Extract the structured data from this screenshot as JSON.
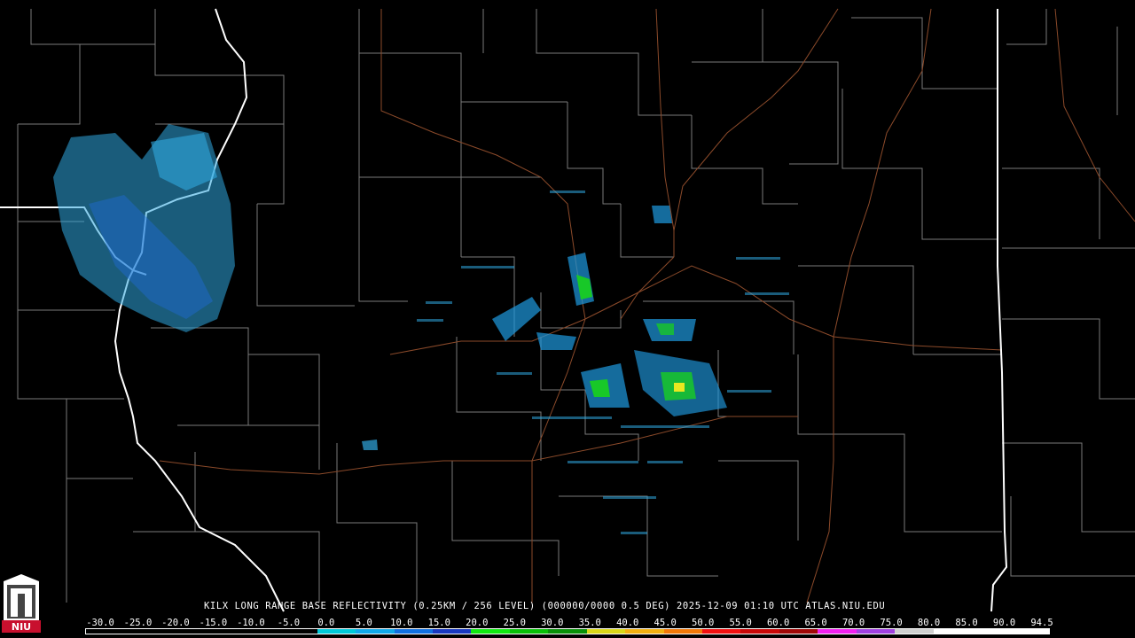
{
  "map": {
    "caption": "KILX LONG RANGE BASE REFLECTIVITY (0.25KM / 256 LEVEL) (000000/0000 0.5 DEG) 2025-12-09 01:10 UTC  ATLAS.NIU.EDU",
    "logo_text": "NIU",
    "colors": {
      "background": "#000000",
      "county_line": "#7a7a7a",
      "state_line": "#ffffff",
      "highway": "#8b4a2a",
      "echo_light": "#30a8e0",
      "echo_mid": "#1e6ad8",
      "echo_heavy": "#18c828",
      "echo_peak": "#e8e820"
    },
    "legend": {
      "labels": [
        "-30.0",
        "-25.0",
        "-20.0",
        "-15.0",
        "-10.0",
        "-5.0",
        "0.0",
        "5.0",
        "10.0",
        "15.0",
        "20.0",
        "25.0",
        "30.0",
        "35.0",
        "40.0",
        "45.0",
        "50.0",
        "55.0",
        "60.0",
        "65.0",
        "70.0",
        "75.0",
        "80.0",
        "85.0",
        "90.0",
        "94.5"
      ],
      "colors": [
        "#000000",
        "#000000",
        "#000000",
        "#000000",
        "#000000",
        "#000000",
        "#00c8d8",
        "#10a8e8",
        "#1070e0",
        "#1838c0",
        "#10e810",
        "#08c008",
        "#089008",
        "#d8d818",
        "#f0b010",
        "#f07808",
        "#f01010",
        "#c80808",
        "#a00808",
        "#f020f0",
        "#a040e0",
        "#d0d0d0",
        "#ffffff",
        "#ffffff",
        "#ffffff"
      ]
    }
  }
}
